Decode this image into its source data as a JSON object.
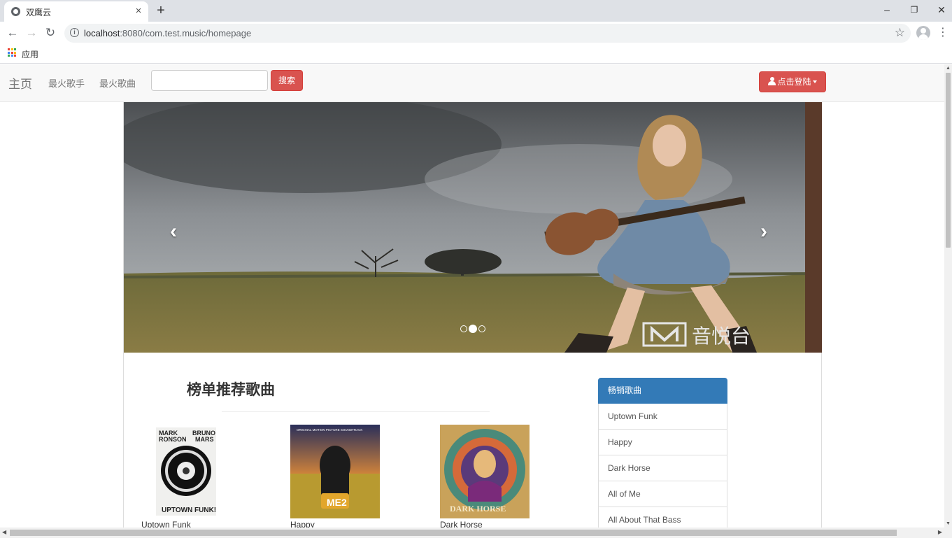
{
  "browser": {
    "tab_title": "双鹰云",
    "tab_close": "×",
    "new_tab": "+",
    "url_host": "localhost",
    "url_rest": ":8080/com.test.music/homepage",
    "bookmarks_label": "应用",
    "window_minimize": "–",
    "window_restore": "❐",
    "window_close": "✕"
  },
  "navbar": {
    "brand": "主页",
    "links": [
      "最火歌手",
      "最火歌曲"
    ],
    "search_placeholder": "",
    "search_button": "搜索",
    "login_button": "点击登陆"
  },
  "carousel": {
    "prev": "‹",
    "next": "›",
    "indicator_count": 3,
    "active_index": 1,
    "watermark": "音悦台"
  },
  "recommend": {
    "title": "榜单推荐歌曲",
    "albums": [
      {
        "name": "Uptown Funk",
        "cover_text_top": "MARK RONSON",
        "cover_text_top2": "BRUNO MARS",
        "cover_text_bottom": "UPTOWN FUNK!"
      },
      {
        "name": "Happy",
        "cover_text_top": "ORIGINAL MOTION PICTURE SOUNDTRACK",
        "cover_text_bottom": "ME2"
      },
      {
        "name": "Dark Horse",
        "cover_text_bottom": "DARK HORSE"
      }
    ]
  },
  "bestsellers": {
    "heading": "畅销歌曲",
    "items": [
      "Uptown Funk",
      "Happy",
      "Dark Horse",
      "All of Me",
      "All About That Bass"
    ]
  },
  "colors": {
    "danger": "#d9534f",
    "primary": "#337ab7",
    "navbar_bg": "#f8f8f8"
  }
}
